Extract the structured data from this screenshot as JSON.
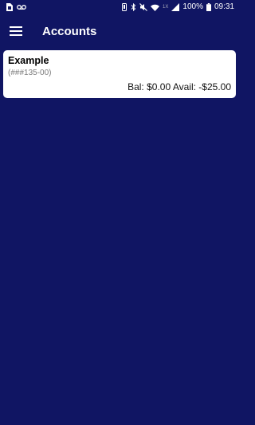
{
  "status_bar": {
    "battery_percent": "100%",
    "time": "09:31",
    "left_icons": [
      "sim-card-icon",
      "voicemail-icon"
    ],
    "right_icons": [
      "vibrate-icon",
      "bluetooth-icon",
      "mute-icon",
      "wifi-icon",
      "signal-icon",
      "battery-icon"
    ],
    "network_label": "1X"
  },
  "app_bar": {
    "title": "Accounts",
    "menu_icon": "hamburger-menu-icon"
  },
  "accounts": [
    {
      "name": "Example",
      "number": "(###135-00)",
      "balance_label": "Bal:",
      "balance_value": "$0.00",
      "available_label": "Avail:",
      "available_value": "-$25.00"
    }
  ],
  "colors": {
    "background": "#101563",
    "card": "#ffffff",
    "secondary_text": "#7a7a7a"
  }
}
